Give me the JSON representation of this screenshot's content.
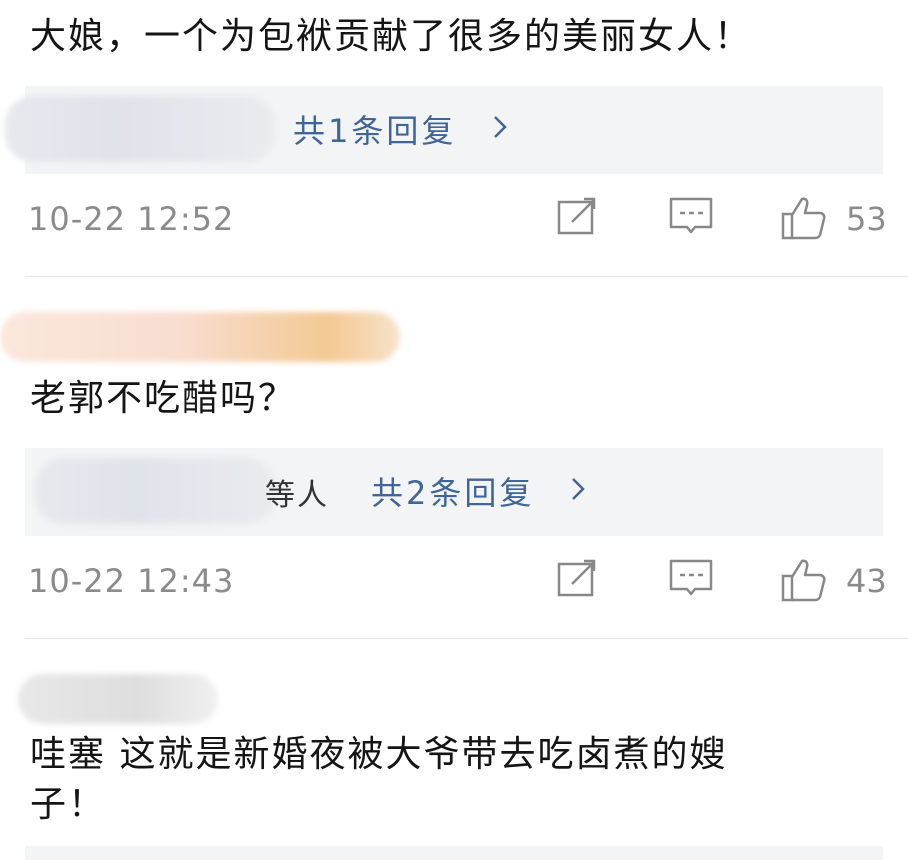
{
  "comments": [
    {
      "text": "大娘，一个为包袱贡献了很多的美丽女人！",
      "reply_partial": "",
      "reply_link": "共1条回复",
      "timestamp": "10-22  12:52",
      "likes": "53"
    },
    {
      "text": "老郭不吃醋吗？",
      "reply_partial": "等人",
      "reply_link": "共2条回复",
      "timestamp": "10-22  12:43",
      "likes": "43"
    },
    {
      "text_line1": "哇塞 这就是新婚夜被大爷带去吃卤煮的嫂",
      "text_line2": "子！"
    }
  ],
  "icons": [
    "edit-icon",
    "comment-icon",
    "thumbs-up-icon",
    "chevron-right-icon"
  ],
  "colors": {
    "reply_link": "#406599",
    "meta_gray": "#8b8b8b",
    "reply_bg": "#f3f4f6"
  }
}
